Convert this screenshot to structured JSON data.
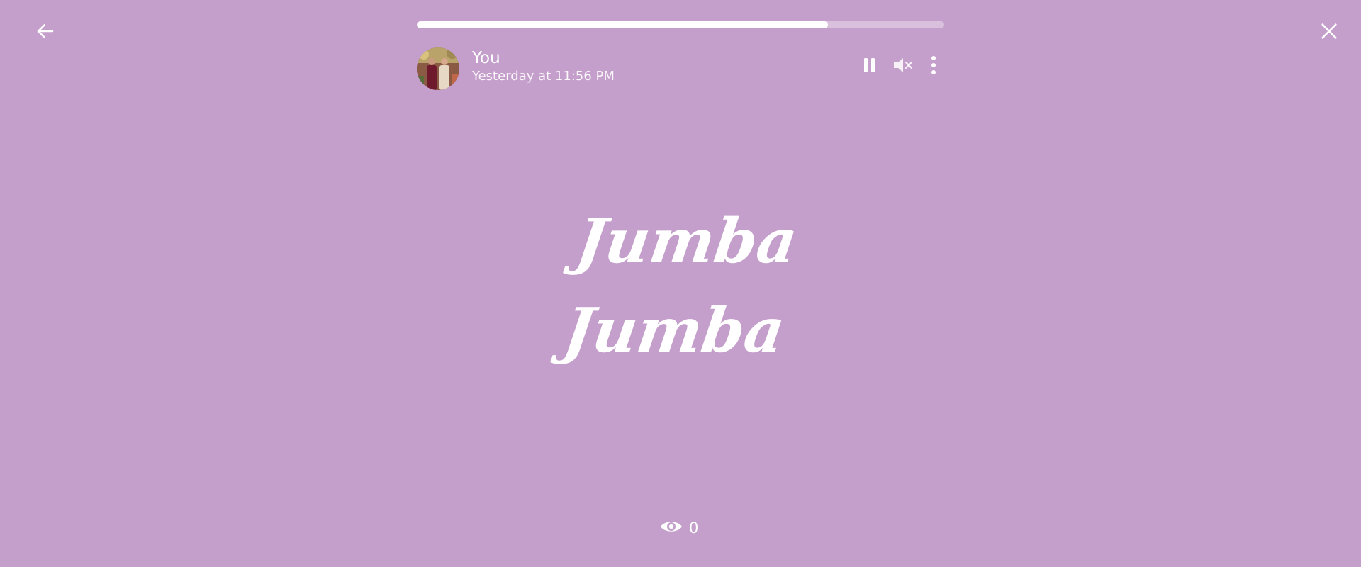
{
  "nav": {
    "back_icon": "arrow-left-icon",
    "close_icon": "close-icon"
  },
  "progress": {
    "value": 0.78
  },
  "status": {
    "author": "You",
    "timestamp": "Yesterday at 11:56 PM",
    "avatar_icon": "profile-photo"
  },
  "controls": {
    "pause_icon": "pause-icon",
    "mute_icon": "volume-muted-icon",
    "menu_icon": "more-vertical-icon"
  },
  "story": {
    "lines": [
      "Jumba",
      "Jumba"
    ]
  },
  "views": {
    "icon": "eye-icon",
    "count": "0"
  },
  "colors": {
    "background": "#c59fcb",
    "foreground": "#ffffff"
  }
}
